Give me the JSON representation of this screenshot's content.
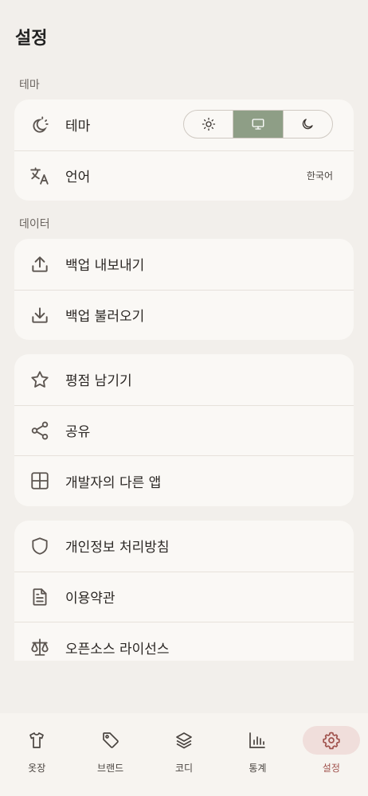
{
  "page": {
    "title": "설정"
  },
  "sections": {
    "theme": {
      "label": "테마",
      "rows": [
        {
          "label": "테마",
          "icon": "theme-icon"
        },
        {
          "label": "언어",
          "value": "한국어",
          "icon": "translate-icon"
        }
      ],
      "segmented": {
        "options": [
          "light",
          "system",
          "dark"
        ],
        "selected": "system"
      }
    },
    "data": {
      "label": "데이터",
      "rows": [
        {
          "label": "백업 내보내기",
          "icon": "upload-icon"
        },
        {
          "label": "백업 불러오기",
          "icon": "download-icon"
        }
      ]
    },
    "more": {
      "rows": [
        {
          "label": "평점 남기기",
          "icon": "star-icon"
        },
        {
          "label": "공유",
          "icon": "share-icon"
        },
        {
          "label": "개발자의 다른 앱",
          "icon": "apps-grid-icon"
        }
      ]
    },
    "legal": {
      "rows": [
        {
          "label": "개인정보 처리방침",
          "icon": "shield-icon"
        },
        {
          "label": "이용약관",
          "icon": "document-icon"
        },
        {
          "label": "오픈소스 라이선스",
          "icon": "scale-icon"
        }
      ]
    }
  },
  "nav": {
    "items": [
      {
        "label": "옷장",
        "icon": "shirt-icon"
      },
      {
        "label": "브랜드",
        "icon": "tag-icon"
      },
      {
        "label": "코디",
        "icon": "layers-icon"
      },
      {
        "label": "통계",
        "icon": "bar-chart-icon"
      },
      {
        "label": "설정",
        "icon": "gear-icon",
        "active": true
      }
    ]
  },
  "colors": {
    "accent": "#8e9e86",
    "active_nav": "#a0524d",
    "active_nav_bg": "#f0dedb"
  }
}
